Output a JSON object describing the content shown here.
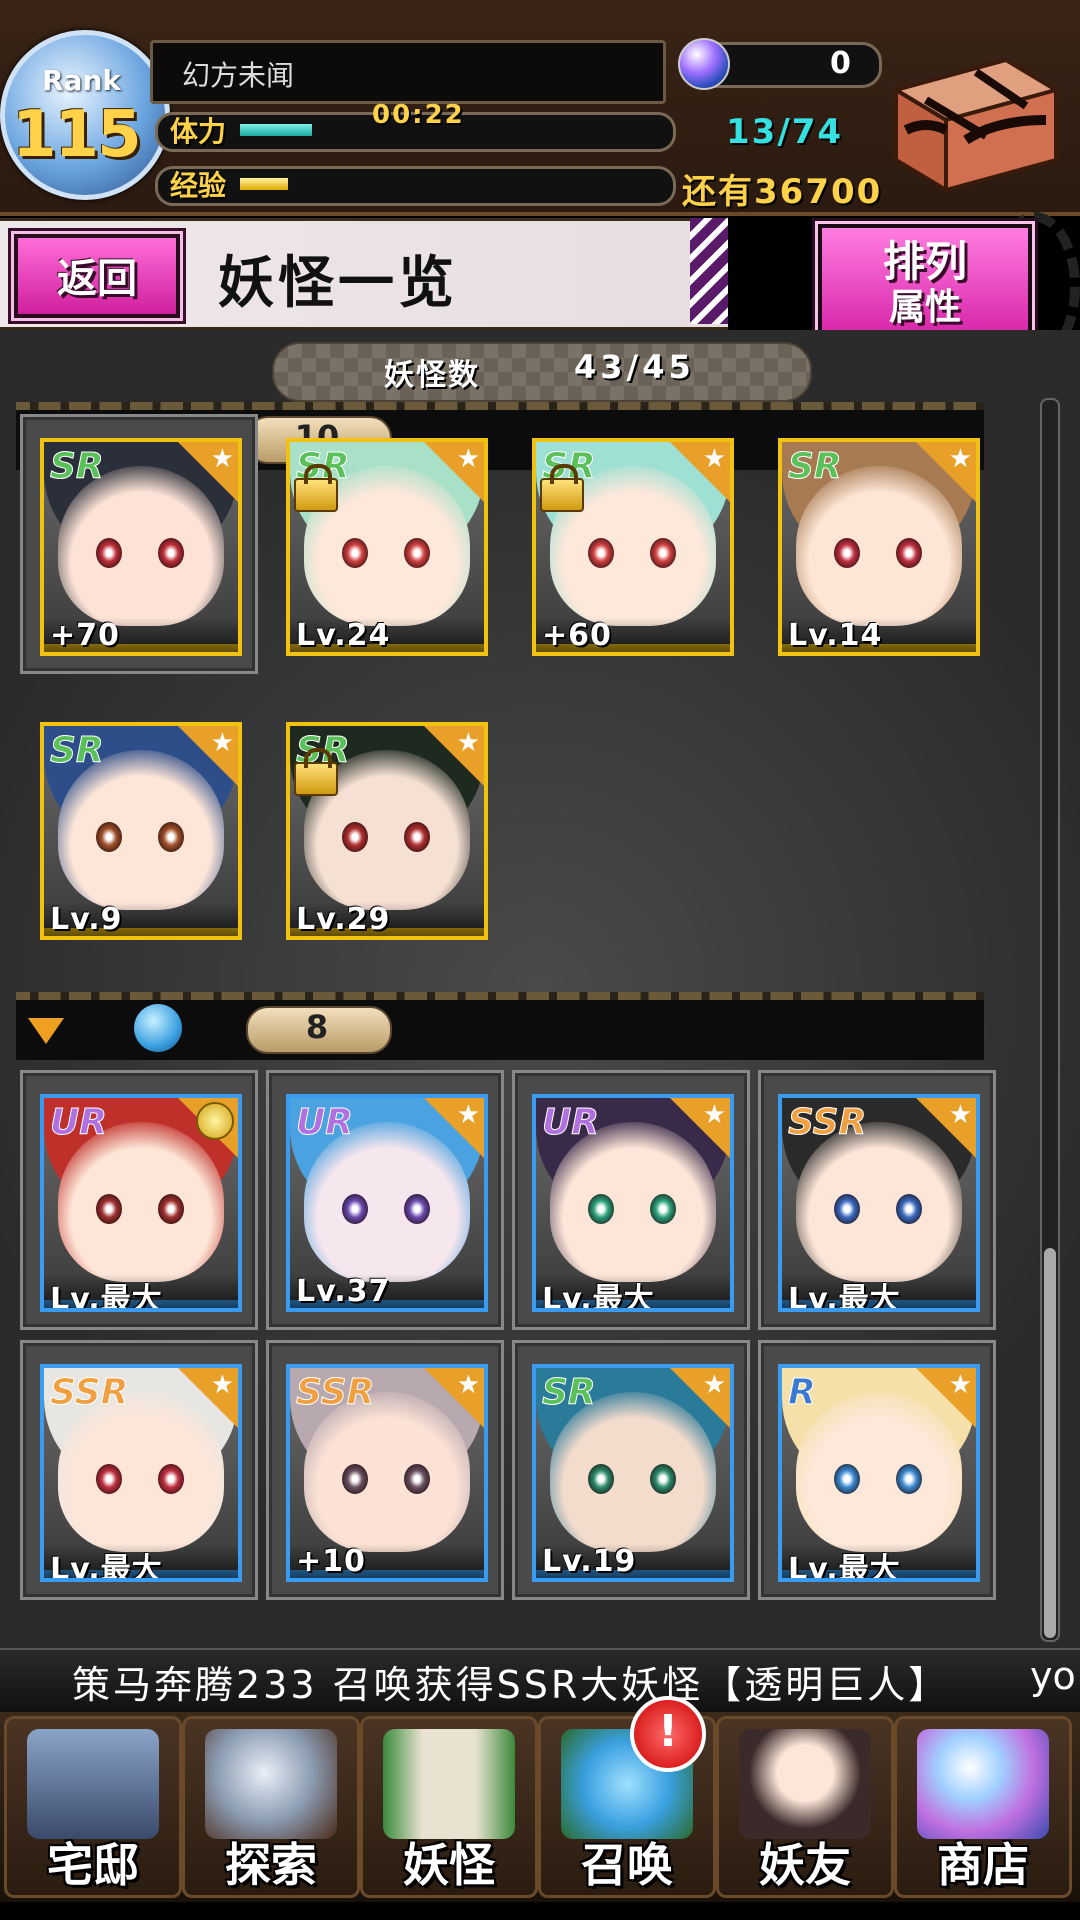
{
  "header": {
    "rank_label": "Rank",
    "rank_value": "115",
    "player_name": "幻方未闻",
    "stamina_label": "体力",
    "stamina_timer": "00:22",
    "stamina_count": "13/74",
    "stamina_progress": 0.18,
    "exp_label": "经验",
    "exp_remaining": "还有36700",
    "exp_progress": 0.12,
    "orb_count": "0"
  },
  "title_bar": {
    "back_label": "返回",
    "page_title": "妖怪一览",
    "sort_label": "排列",
    "sort_sub": "属性"
  },
  "monster_count": {
    "label": "妖怪数",
    "value": "43/45"
  },
  "groups": [
    {
      "icon": "gold-attribute-icon",
      "count": "10",
      "cards": [
        {
          "rarity": "SR",
          "level": "+70",
          "locked": false,
          "hair": "#2a2f3a",
          "skin": "#fde3d6",
          "eye": "#c0303a"
        },
        {
          "rarity": "SR",
          "level": "Lv.24",
          "locked": true,
          "hair": "#a9e0c8",
          "skin": "#fde8da",
          "eye": "#d04040"
        },
        {
          "rarity": "SR",
          "level": "+60",
          "locked": true,
          "hair": "#9fe0d4",
          "skin": "#fde8da",
          "eye": "#d04040"
        },
        {
          "rarity": "SR",
          "level": "Lv.14",
          "locked": false,
          "hair": "#a87a52",
          "skin": "#fde6d6",
          "eye": "#c03040"
        },
        {
          "rarity": "SR",
          "level": "Lv.9",
          "locked": false,
          "hair": "#2e4e8a",
          "skin": "#fde6d8",
          "eye": "#a0502a"
        },
        {
          "rarity": "SR",
          "level": "Lv.29",
          "locked": true,
          "hair": "#1e2a20",
          "skin": "#f6e0d4",
          "eye": "#b03030"
        }
      ]
    },
    {
      "icon": "water-attribute-icon",
      "count": "8",
      "cards": [
        {
          "rarity": "UR",
          "level": "Lv.最大",
          "medal": true,
          "hair": "#c0302a",
          "skin": "#fde6d8",
          "eye": "#a03030"
        },
        {
          "rarity": "UR",
          "level": "Lv.37",
          "hair": "#4aa2e0",
          "skin": "#f6e6ee",
          "eye": "#6a4ab0"
        },
        {
          "rarity": "UR",
          "level": "Lv.最大",
          "hair": "#3a2a4a",
          "skin": "#fde6d8",
          "eye": "#2aa07a"
        },
        {
          "rarity": "SSR",
          "level": "Lv.最大",
          "hair": "#2a2a2a",
          "skin": "#fde6d8",
          "eye": "#3a6ac0"
        },
        {
          "rarity": "SSR",
          "level": "Lv.最大",
          "hair": "#e8e6e2",
          "skin": "#fde6d8",
          "eye": "#c03040"
        },
        {
          "rarity": "SSR",
          "level": "+10",
          "hair": "#b8a8b0",
          "skin": "#fbe2d4",
          "eye": "#6a5060"
        },
        {
          "rarity": "SR",
          "level": "Lv.19",
          "hair": "#2a7a9a",
          "skin": "#f4dccc",
          "eye": "#2a8a6a"
        },
        {
          "rarity": "R",
          "level": "Lv.最大",
          "hair": "#f4e0a8",
          "skin": "#fde8da",
          "eye": "#3a8ad0"
        }
      ]
    }
  ],
  "ticker": {
    "text": "策马奔腾233 召唤获得SSR大妖怪【透明巨人】",
    "text2": "yo"
  },
  "nav": [
    {
      "label": "宅邸",
      "icon": "mansion-icon"
    },
    {
      "label": "探索",
      "icon": "magnifier-map-icon"
    },
    {
      "label": "妖怪",
      "icon": "scroll-icon"
    },
    {
      "label": "召唤",
      "icon": "pentagram-icon",
      "alert": "!"
    },
    {
      "label": "妖友",
      "icon": "catgirl-friend-icon"
    },
    {
      "label": "商店",
      "icon": "crystal-orb-icon"
    }
  ],
  "colors": {
    "gold_frame": "#f2c210",
    "blue_frame": "#3a9cf0",
    "pink_button": "#d51fa6",
    "accent_cyan": "#35e0e0",
    "accent_yellow": "#ffd24a"
  }
}
